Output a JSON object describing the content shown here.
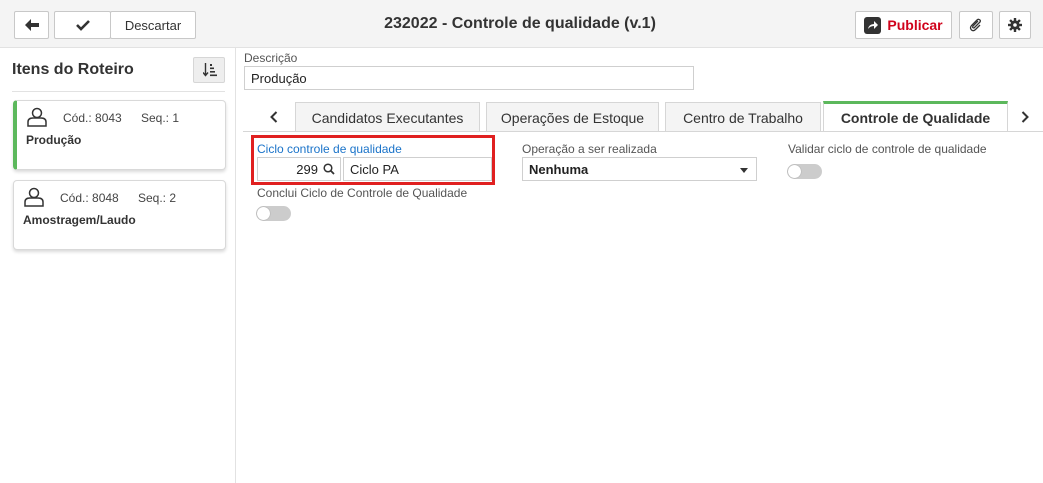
{
  "toolbar": {
    "back_icon": "arrow-left-icon",
    "save_icon": "check-icon",
    "discard_label": "Descartar",
    "title": "232022 - Controle de qualidade (v.1)",
    "publish_label": "Publicar",
    "attach_icon": "paperclip-icon",
    "settings_icon": "gear-icon"
  },
  "sidebar": {
    "title": "Itens do Roteiro",
    "sort_icon": "sort-icon",
    "items": [
      {
        "cod": "Cód.: 8043",
        "seq": "Seq.: 1",
        "name": "Produção",
        "active": true
      },
      {
        "cod": "Cód.: 8048",
        "seq": "Seq.: 2",
        "name": "Amostragem/Laudo",
        "active": false
      }
    ]
  },
  "form": {
    "descricao_label": "Descrição",
    "descricao_value": "Produção"
  },
  "tabs": [
    {
      "label": "Candidatos Executantes",
      "active": false
    },
    {
      "label": "Operações de Estoque",
      "active": false
    },
    {
      "label": "Centro de Trabalho",
      "active": false
    },
    {
      "label": "Controle de Qualidade",
      "active": true
    }
  ],
  "qc": {
    "ciclo_label": "Ciclo controle de qualidade",
    "ciclo_code": "299",
    "ciclo_name": "Ciclo PA",
    "operacao_label": "Operação a ser realizada",
    "operacao_value": "Nenhuma",
    "validar_label": "Validar ciclo de controle de qualidade",
    "validar_on": false,
    "conclui_label": "Conclui Ciclo de Controle de Qualidade",
    "conclui_on": false
  },
  "colors": {
    "accent_green": "#5cb85c",
    "publish_red": "#d0021b",
    "highlight_red": "#e02020",
    "link_blue": "#1a73c9"
  }
}
